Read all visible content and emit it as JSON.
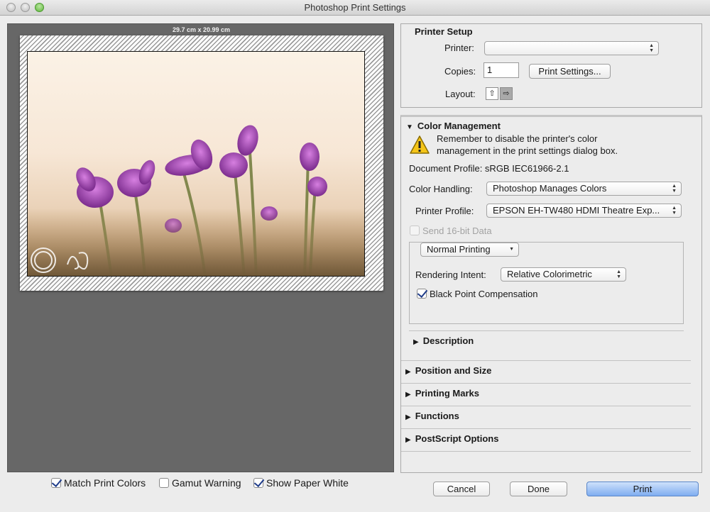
{
  "window": {
    "title": "Photoshop Print Settings"
  },
  "preview": {
    "paper_size": "29.7 cm x 20.99 cm"
  },
  "bottom_options": [
    {
      "label": "Match Print Colors",
      "checked": true
    },
    {
      "label": "Gamut Warning",
      "checked": false
    },
    {
      "label": "Show Paper White",
      "checked": true
    }
  ],
  "printer_setup": {
    "heading": "Printer Setup",
    "printer_label": "Printer:",
    "printer_value": "",
    "copies_label": "Copies:",
    "copies_value": "1",
    "print_settings_label": "Print Settings...",
    "layout_label": "Layout:"
  },
  "color_management": {
    "heading": "Color Management",
    "warning_line1": "Remember to disable the printer's color",
    "warning_line2": "management in the print settings dialog box.",
    "document_profile": "Document Profile: sRGB IEC61966-2.1",
    "color_handling_label": "Color Handling:",
    "color_handling_value": "Photoshop Manages Colors",
    "printer_profile_label": "Printer Profile:",
    "printer_profile_value": "EPSON EH-TW480 HDMI Theatre Exp...",
    "send16_label": "Send 16-bit Data",
    "mode_value": "Normal Printing",
    "rendering_intent_label": "Rendering Intent:",
    "rendering_intent_value": "Relative Colorimetric",
    "bpc_label": "Black Point Compensation",
    "description_label": "Description"
  },
  "sections": [
    "Position and Size",
    "Printing Marks",
    "Functions",
    "PostScript Options"
  ],
  "buttons": {
    "cancel": "Cancel",
    "done": "Done",
    "print": "Print"
  },
  "colors": {
    "preview_bg": "#676767",
    "print_button": "#7fadf0",
    "checkbox_mark": "#1f3c8a"
  }
}
